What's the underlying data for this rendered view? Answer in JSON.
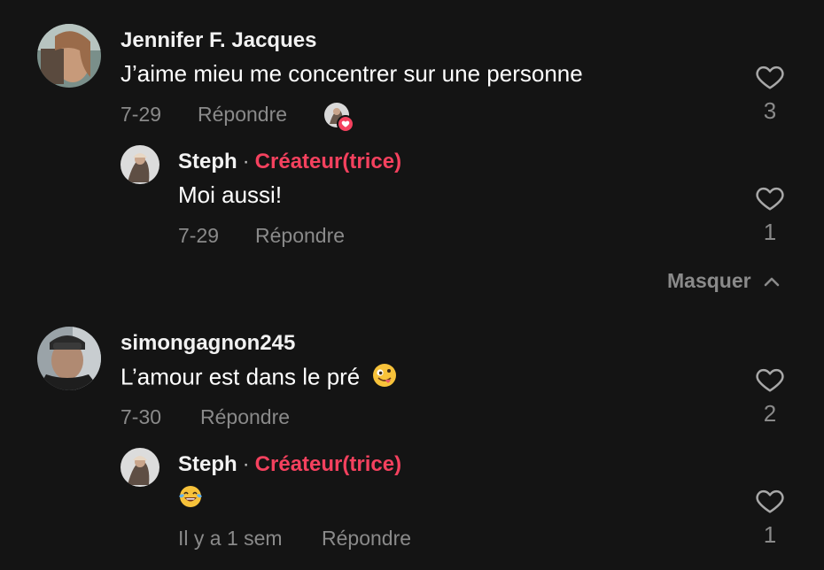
{
  "comments": [
    {
      "username": "Jennifer F. Jacques",
      "text": "J’aime mieu me concentrer sur une personne",
      "date": "7-29",
      "reply_label": "Répondre",
      "likes": "3",
      "reply": {
        "username": "Steph",
        "separator": "·",
        "role": "Créateur(trice)",
        "text": "Moi aussi!",
        "date": "7-29",
        "reply_label": "Répondre",
        "likes": "1"
      }
    },
    {
      "username": "simongagnon245",
      "text": "L’amour est dans le pré",
      "text_emoji": "zany-face",
      "date": "7-30",
      "reply_label": "Répondre",
      "likes": "2",
      "reply": {
        "username": "Steph",
        "separator": "·",
        "role": "Créateur(trice)",
        "text_emoji": "tears-of-joy",
        "date": "Il y a 1 sem",
        "reply_label": "Répondre",
        "likes": "1"
      }
    }
  ],
  "hide_replies_label": "Masquer",
  "colors": {
    "background": "#141414",
    "creator_accent": "#f4415e",
    "muted_text": "#8a8a8a"
  }
}
